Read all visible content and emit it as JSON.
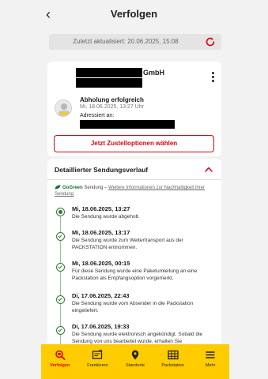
{
  "header": {
    "title": "Verfolgen",
    "back_glyph": "‹"
  },
  "update_bar": {
    "text": "Zuletzt aktualisiert: 20.06.2025, 15:08"
  },
  "shipment": {
    "company_suffix": "GmbH",
    "status_title": "Abholung erfolgreich",
    "status_date": "Mi, 18.06.2025, 13:27 Uhr",
    "addressed_label": "Adressiert an:",
    "cta_label": "Jetzt Zustelloptionen wählen"
  },
  "history": {
    "title": "Detaillierter Sendungsverlauf",
    "gogreen_brand": "GoGreen",
    "gogreen_word": "Sendung",
    "gogreen_sep": " – ",
    "gogreen_link": "Weitere Informationen zur Nachhaltigkeit ihrer Sendung",
    "events": [
      {
        "date": "Mi, 18.06.2025, 13:27",
        "text": "Die Sendung wurde abgeholt."
      },
      {
        "date": "Mi, 18.06.2025, 13:17",
        "text": "Die Sendung wurde zum Weitertransport aus der PACKSTATION entnommen."
      },
      {
        "date": "Mi, 18.06.2025, 00:15",
        "text": "Für diese Sendung wurde eine Paketumleitung an eine Packstation als Empfangsoption vorgemerkt."
      },
      {
        "date": "Di, 17.06.2025, 22:43",
        "text": "Die Sendung wurde vom Absender in die Packstation eingeliefert."
      },
      {
        "date": "Di, 17.06.2025, 19:33",
        "text": "Die Sendung wurde elektronisch angekündigt. Sobald die Sendung von uns bearbeitet wurde, erhalten Sie"
      }
    ]
  },
  "bottom_nav": {
    "items": [
      {
        "label": "Verfolgen",
        "icon": "search-package-icon",
        "active": true
      },
      {
        "label": "Frankieren",
        "icon": "stamp-icon",
        "active": false
      },
      {
        "label": "Standorte",
        "icon": "location-pin-icon",
        "active": false
      },
      {
        "label": "Packstation",
        "icon": "packstation-icon",
        "active": false
      },
      {
        "label": "Mehr",
        "icon": "menu-icon",
        "active": false
      }
    ]
  },
  "colors": {
    "brand_red": "#d40511",
    "brand_yellow": "#ffcc00",
    "timeline_green": "#2e7d32"
  }
}
